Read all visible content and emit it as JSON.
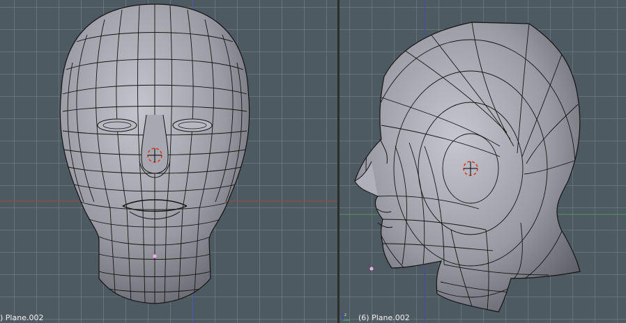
{
  "viewports": {
    "front": {
      "label": ") Plane.002"
    },
    "side": {
      "label": "(6) Plane.002"
    }
  },
  "colors": {
    "background": "#4e5a62",
    "grid": "#78848c",
    "x_axis": "#a0463c",
    "y_axis": "#4a9a5a",
    "z_axis": "#3c4ca8",
    "mesh_fill": "#9a9aa2",
    "mesh_wire": "#141414",
    "cursor": "#e03020",
    "vertex": "#ffaaff"
  },
  "icons": {
    "cursor": "3d-cursor-icon",
    "axes": "axis-gizmo-icon"
  }
}
